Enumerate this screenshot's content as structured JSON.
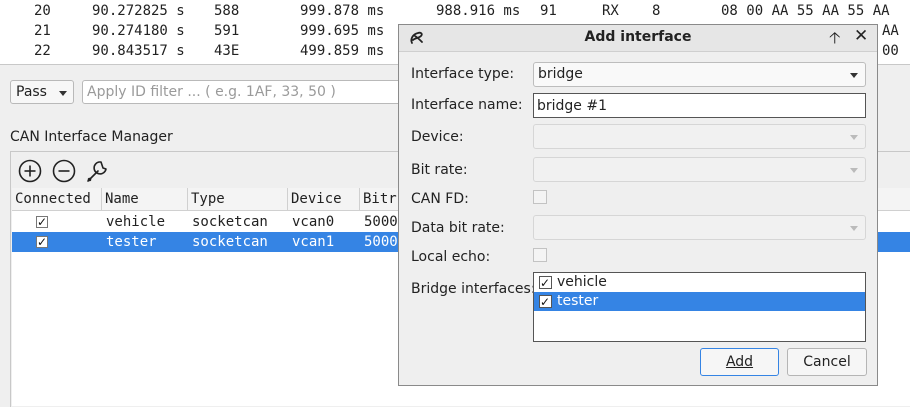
{
  "trace": {
    "rows": [
      {
        "index": "20",
        "time": "90.272825 s",
        "id": "588",
        "period": "999.878 ms",
        "delta": "988.916 ms",
        "tag": "91",
        "dir": "RX",
        "dlc": "8",
        "data": "08 00 AA 55 AA 55 AA"
      },
      {
        "index": "21",
        "time": "90.274180 s",
        "id": "591",
        "period": "999.695 ms",
        "delta": "",
        "tag": "",
        "dir": "",
        "dlc": "",
        "data": "AA"
      },
      {
        "index": "22",
        "time": "90.843517 s",
        "id": "43E",
        "period": "499.859 ms",
        "delta": "",
        "tag": "",
        "dir": "",
        "dlc": "",
        "data": "00"
      }
    ]
  },
  "filter": {
    "mode_value": "Pass",
    "id_filter_placeholder": "Apply ID filter ... ( e.g. 1AF, 33, 50 )"
  },
  "manager": {
    "title": "CAN Interface Manager",
    "toolbar": {
      "add_icon": "plus-circle-icon",
      "remove_icon": "minus-circle-icon",
      "configure_icon": "wrench-icon"
    },
    "columns": [
      "Connected",
      "Name",
      "Type",
      "Device",
      "Bitr"
    ],
    "rows": [
      {
        "connected": true,
        "name": "vehicle",
        "type": "socketcan",
        "device": "vcan0",
        "bitrate": "5000",
        "selected": false
      },
      {
        "connected": true,
        "name": "tester",
        "type": "socketcan",
        "device": "vcan1",
        "bitrate": "5000",
        "selected": true
      }
    ]
  },
  "dialog": {
    "title": "Add interface",
    "fields": {
      "interface_type_label": "Interface type:",
      "interface_type_value": "bridge",
      "interface_name_label": "Interface name:",
      "interface_name_value": "bridge #1",
      "device_label": "Device:",
      "bit_rate_label": "Bit rate:",
      "can_fd_label": "CAN FD:",
      "data_bit_rate_label": "Data bit rate:",
      "local_echo_label": "Local echo:",
      "bridge_interfaces_label": "Bridge interfaces:"
    },
    "bridge_interfaces": [
      {
        "name": "vehicle",
        "checked": true,
        "selected": false
      },
      {
        "name": "tester",
        "checked": true,
        "selected": true
      }
    ],
    "add_label": "Add",
    "cancel_label": "Cancel"
  },
  "colors": {
    "selection": "#3584e4",
    "window_bg": "#efefef"
  }
}
